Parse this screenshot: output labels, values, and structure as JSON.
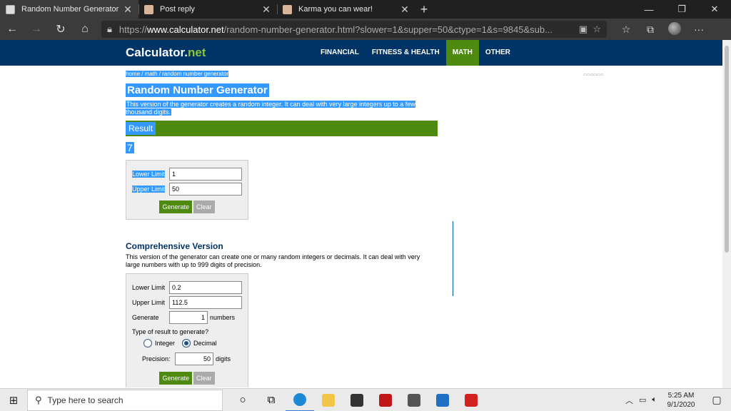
{
  "browser": {
    "tabs": [
      {
        "title": "Random Number Generator",
        "active": true
      },
      {
        "title": "Post reply",
        "active": false
      },
      {
        "title": "Karma you can wear!",
        "active": false
      }
    ],
    "url_scheme": "https://",
    "url_domain": "www.calculator.net",
    "url_path": "/random-number-generator.html?slower=1&supper=50&ctype=1&s=9845&sub..."
  },
  "site": {
    "logo_main": "Calculator",
    "logo_tld": "net",
    "nav": [
      "FINANCIAL",
      "FITNESS & HEALTH",
      "MATH",
      "OTHER"
    ],
    "nav_active": "MATH"
  },
  "page": {
    "breadcrumb": "home / math / random number generator",
    "title": "Random Number Generator",
    "description": "This version of the generator creates a random integer. It can deal with very large integers up to a few thousand digits.",
    "result_heading": "Result",
    "result_value": "7",
    "simple_form": {
      "lower_label": "Lower Limit",
      "lower_value": "1",
      "upper_label": "Upper Limit",
      "upper_value": "50",
      "generate_label": "Generate",
      "clear_label": "Clear"
    },
    "comprehensive": {
      "heading": "Comprehensive Version",
      "description": "This version of the generator can create one or many random integers or decimals. It can deal with very large numbers with up to 999 digits of precision.",
      "lower_label": "Lower Limit",
      "lower_value": "0.2",
      "upper_label": "Upper Limit",
      "upper_value": "112.5",
      "generate_label": "Generate",
      "generate_count": "1",
      "numbers_label": "numbers",
      "type_label": "Type of result to generate?",
      "integer_label": "Integer",
      "decimal_label": "Decimal",
      "selected_type": "Decimal",
      "precision_label": "Precision:",
      "precision_value": "50",
      "digits_label": "digits",
      "generate_button": "Generate",
      "clear_button": "Clear"
    }
  },
  "taskbar": {
    "search_placeholder": "Type here to search",
    "time": "5:25 AM",
    "date": "9/1/2020"
  },
  "colors": {
    "header": "#003366",
    "accent_green": "#4f8a10",
    "selection": "#3399ff"
  }
}
